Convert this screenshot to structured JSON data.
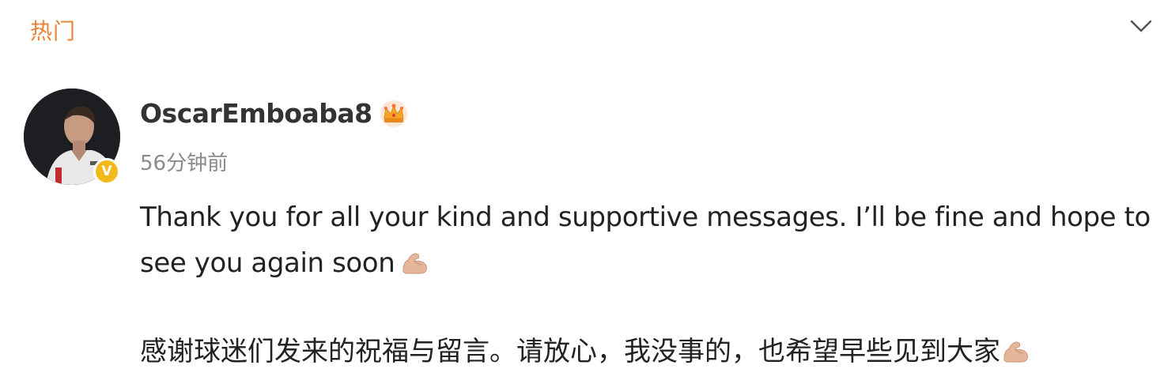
{
  "header": {
    "hot_tab_label": "热门",
    "expand_icon": "chevron-down-icon"
  },
  "post": {
    "author": {
      "username": "OscarEmboaba8",
      "avatar_icon": "avatar",
      "verified_badge_text": "V",
      "member_badge_icon": "crown-icon"
    },
    "timestamp": "56分钟前",
    "content_en": "Thank you for all your kind and supportive messages. I’ll be fine and hope to see you again soon",
    "content_zh": "感谢球迷们发来的祝福与留言。请放心，我没事的，也希望早些见到大家",
    "emoji_icon": "flexed-biceps-icon"
  },
  "colors": {
    "hot_tab": "#e8833a",
    "verified_badge": "#f3b81a",
    "username": "#333333",
    "timestamp": "#8a8a8a",
    "body_text": "#222222"
  }
}
